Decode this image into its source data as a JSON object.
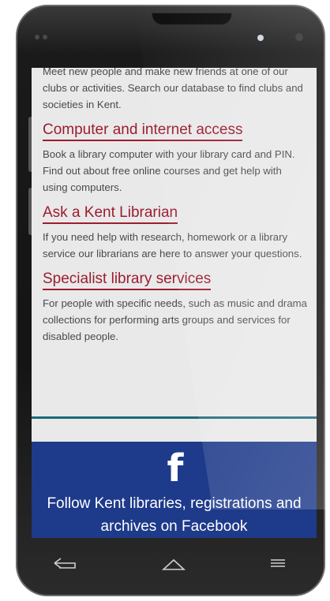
{
  "page": {
    "intro_text": "Meet new people and make new friends at one of our clubs or activities. Search our database to find clubs and societies in Kent.",
    "sections": [
      {
        "heading": "Computer and internet access",
        "body": "Book a library computer with your library card and PIN. Find out about free online courses and get help with using computers."
      },
      {
        "heading": "Ask a Kent Librarian",
        "body": "If you need help with research, homework or a library service our librarians are here to answer your questions."
      },
      {
        "heading": "Specialist library services",
        "body": "For people with specific needs, such as music and drama collections for performing arts groups and services for disabled people."
      }
    ]
  },
  "facebook": {
    "icon": "facebook-icon",
    "text": "Follow Kent libraries, registrations and archives on Facebook"
  },
  "colors": {
    "heading": "#9c1d2e",
    "footer_bg": "#1e3a8a",
    "divider": "#1d6a7a"
  },
  "system_nav": {
    "back_icon": "back-icon",
    "home_icon": "home-icon",
    "menu_icon": "menu-icon"
  }
}
